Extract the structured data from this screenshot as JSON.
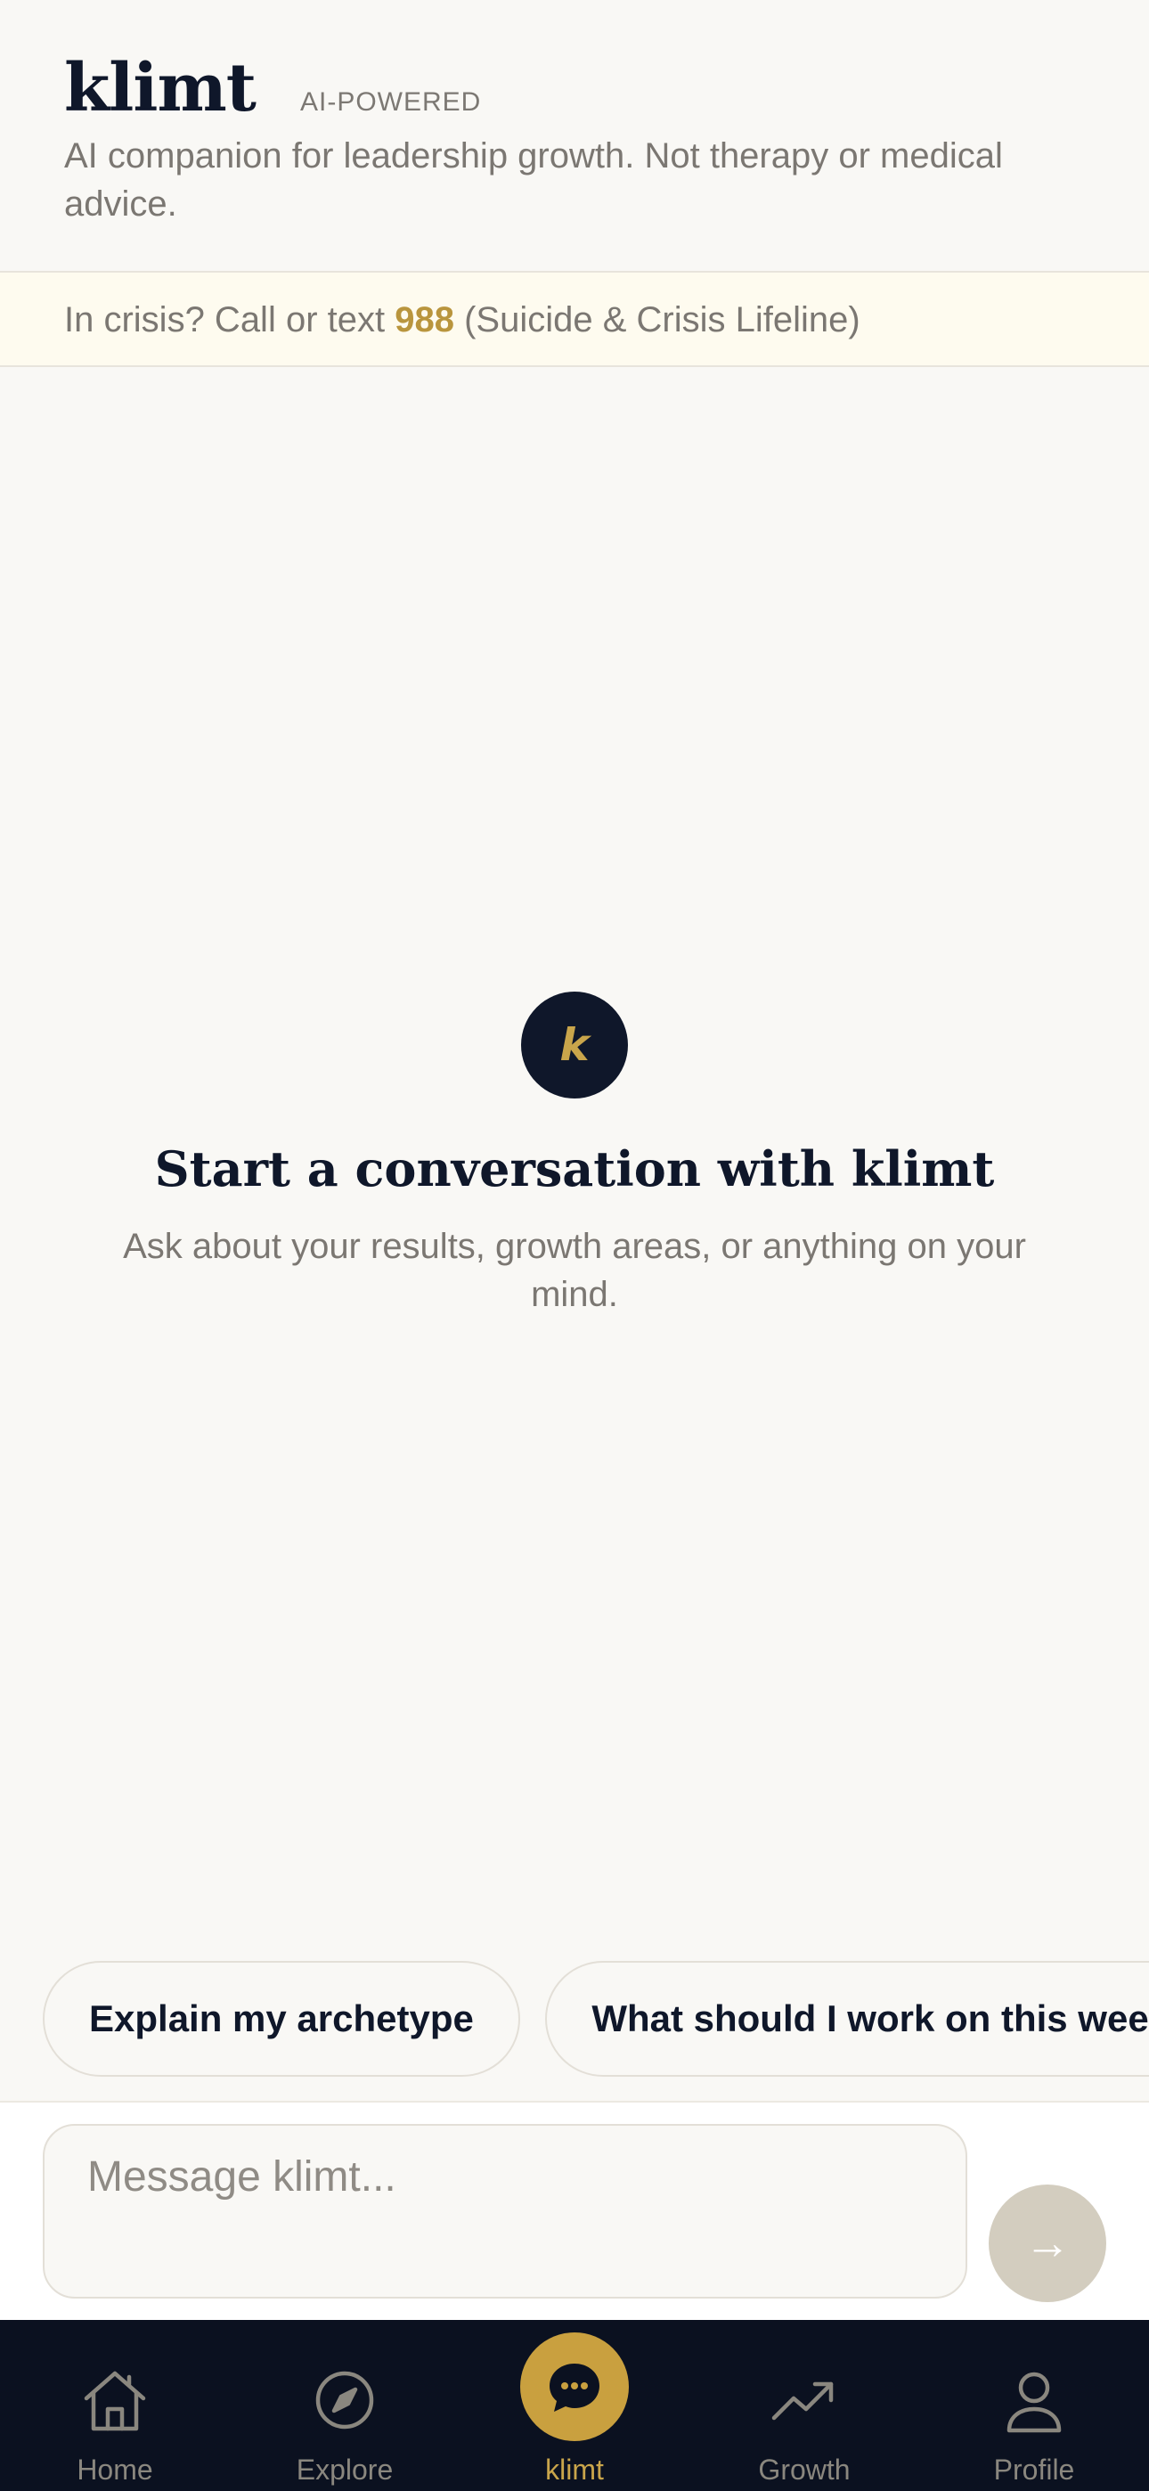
{
  "header": {
    "brand": "klimt",
    "badge": "AI-POWERED",
    "subtitle": "AI companion for leadership growth. Not therapy or medical advice."
  },
  "crisis": {
    "prefix": "In crisis? Call or text ",
    "number": "988",
    "suffix": " (Suicide & Crisis Lifeline)"
  },
  "empty_state": {
    "avatar_letter": "k",
    "title": "Start a conversation with klimt",
    "subtitle": "Ask about your results, growth areas, or anything on your mind."
  },
  "suggestions": [
    {
      "label": "Explain my archetype"
    },
    {
      "label": "What should I work on this week?"
    }
  ],
  "composer": {
    "placeholder": "Message klimt...",
    "send_icon": "→"
  },
  "nav": {
    "items": [
      {
        "label": "Home",
        "icon": "home-icon"
      },
      {
        "label": "Explore",
        "icon": "compass-icon"
      },
      {
        "label": "klimt",
        "icon": "chat-icon",
        "active": true
      },
      {
        "label": "Growth",
        "icon": "trend-up-icon"
      },
      {
        "label": "Profile",
        "icon": "user-icon"
      }
    ]
  },
  "colors": {
    "accent": "#c9a03f",
    "navy": "#0f172a",
    "background": "#f9f8f5",
    "crisis_background": "#fefbef"
  }
}
